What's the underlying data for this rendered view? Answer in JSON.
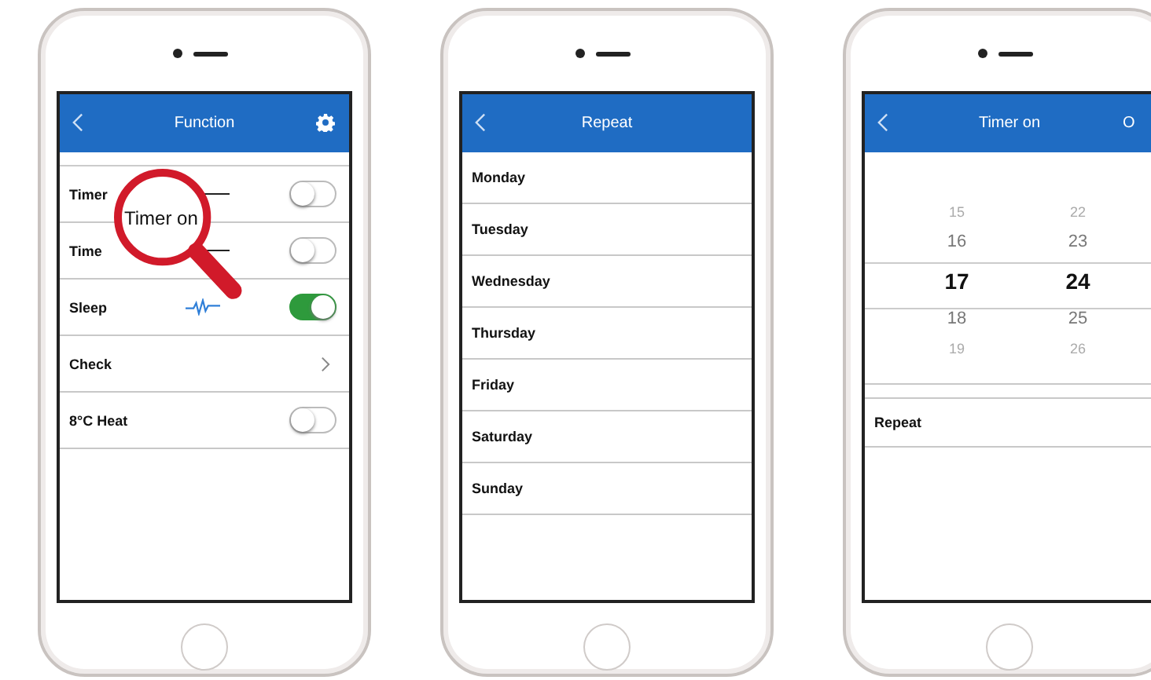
{
  "phones": [
    {
      "kind": "function",
      "title": "Function",
      "rows": [
        {
          "kind": "toggle",
          "label": "Timer",
          "line_mark": true,
          "on": false
        },
        {
          "kind": "toggle",
          "label": "Time",
          "line_mark": true,
          "on": false
        },
        {
          "kind": "toggle",
          "label": "Sleep",
          "pulse_mark": true,
          "on": true
        },
        {
          "kind": "link",
          "label": "Check"
        },
        {
          "kind": "toggle",
          "label": "8°C Heat",
          "on": false
        }
      ],
      "magnifier": {
        "text": "Timer on"
      }
    },
    {
      "kind": "list",
      "title": "Repeat",
      "items": [
        "Monday",
        "Tuesday",
        "Wednesday",
        "Thursday",
        "Friday",
        "Saturday",
        "Sunday"
      ]
    },
    {
      "kind": "picker",
      "title": "Timer on",
      "action": "O",
      "hours": [
        {
          "label": "15",
          "selected": false
        },
        {
          "label": "16",
          "selected": false
        },
        {
          "label": "17",
          "selected": true
        },
        {
          "label": "18",
          "selected": false
        },
        {
          "label": "19",
          "selected": false
        }
      ],
      "minutes": [
        {
          "label": "22",
          "selected": false
        },
        {
          "label": "23",
          "selected": false
        },
        {
          "label": "24",
          "selected": true
        },
        {
          "label": "25",
          "selected": false
        },
        {
          "label": "26",
          "selected": false
        }
      ],
      "rows": [
        "Repeat"
      ]
    }
  ]
}
